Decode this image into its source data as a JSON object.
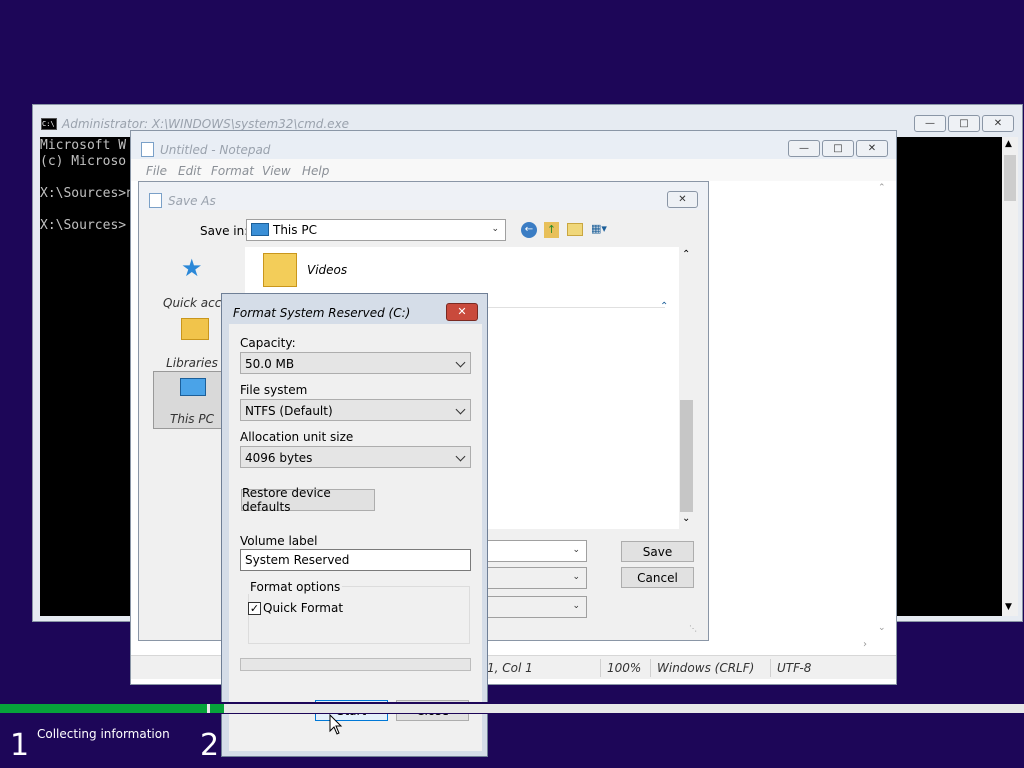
{
  "cmd": {
    "title": "Administrator: X:\\WINDOWS\\system32\\cmd.exe",
    "lines": [
      "Microsoft W",
      "(c) Microso",
      "X:\\Sources>n",
      "X:\\Sources>"
    ]
  },
  "notepad": {
    "title": "Untitled - Notepad",
    "menu": [
      "File",
      "Edit",
      "Format",
      "View",
      "Help"
    ],
    "status": {
      "position": "1, Col 1",
      "zoom": "100%",
      "line_ending": "Windows (CRLF)",
      "encoding": "UTF-8"
    }
  },
  "saveas": {
    "title": "Save As",
    "save_in_label": "Save in:",
    "save_in_value": "This PC",
    "places": [
      "Quick access",
      "Libraries",
      "This PC"
    ],
    "items": [
      "Videos"
    ],
    "save_button": "Save",
    "cancel_button": "Cancel"
  },
  "format": {
    "title": "Format System Reserved (C:)",
    "capacity_label": "Capacity:",
    "capacity_value": "50.0 MB",
    "filesystem_label": "File system",
    "filesystem_value": "NTFS (Default)",
    "alloc_label": "Allocation unit size",
    "alloc_value": "4096 bytes",
    "restore_button": "Restore device defaults",
    "volume_label": "Volume label",
    "volume_value": "System Reserved",
    "options_group": "Format options",
    "quick_format": "Quick Format",
    "quick_format_checked": true,
    "progress": 0,
    "start_button": "Start",
    "close_button": "Close"
  },
  "setup": {
    "step1_number": "1",
    "step1_text": "Collecting information",
    "step2_number": "2"
  },
  "colors": {
    "desktop": "#1d0658",
    "progress_fill": "#07a33a"
  }
}
